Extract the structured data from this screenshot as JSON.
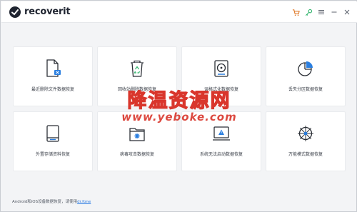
{
  "app": {
    "name": "recoverit"
  },
  "toolbar": {
    "icons": [
      "cart-icon",
      "key-icon",
      "menu-icon",
      "minimize-icon",
      "close-icon"
    ]
  },
  "cards": [
    {
      "label": "最近删除文件数据恢复",
      "icon": "deleted-file-icon"
    },
    {
      "label": "回收站删除数据恢复",
      "icon": "recycle-bin-icon"
    },
    {
      "label": "误格式化数据恢复",
      "icon": "formatted-disk-icon"
    },
    {
      "label": "丢失分区数据恢复",
      "icon": "lost-partition-icon"
    },
    {
      "label": "外置存储资料恢复",
      "icon": "external-storage-icon"
    },
    {
      "label": "病毒攻击数据恢复",
      "icon": "virus-attack-icon"
    },
    {
      "label": "系统无法启动数据恢复",
      "icon": "system-crash-icon"
    },
    {
      "label": "万能模式数据恢复",
      "icon": "all-around-icon"
    }
  ],
  "footer": {
    "text": "Android和iOS设备数据恢复，请使用",
    "link": "dr.fone"
  },
  "watermark": {
    "title": "降温资源网",
    "url": "www.yeboke.com"
  },
  "colors": {
    "accent": "#2a7ae2",
    "icon": "#2b2f36",
    "watermark": "#d9362c"
  }
}
